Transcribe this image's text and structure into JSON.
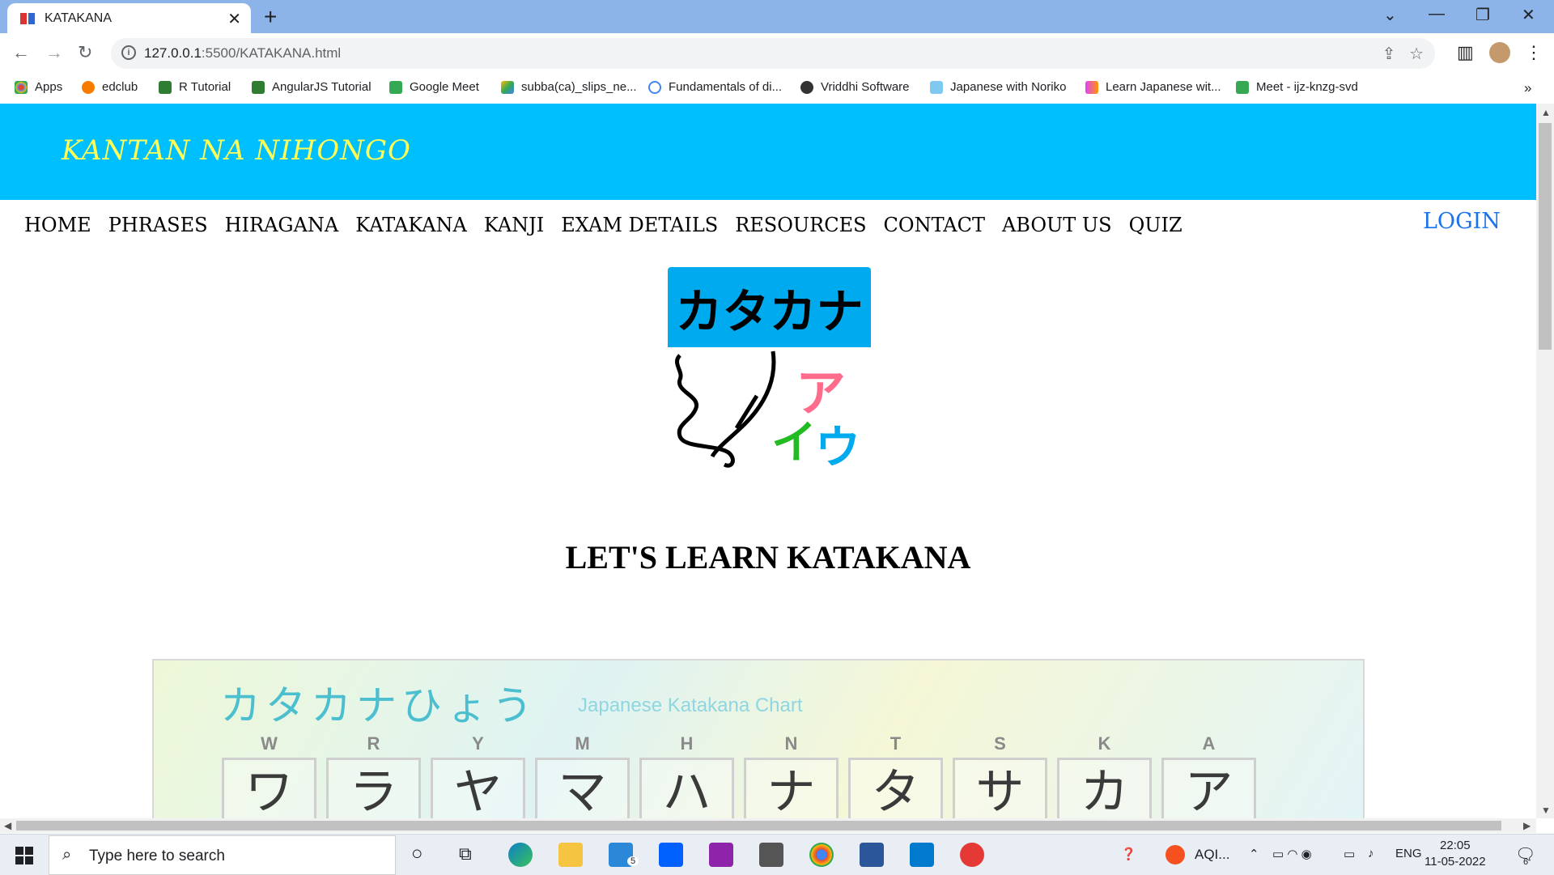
{
  "browser": {
    "tab_title": "KATAKANA",
    "url_host": "127.0.0.1",
    "url_rest": ":5500/KATAKANA.html",
    "bookmarks": [
      {
        "label": "Apps",
        "color": "#ea4335"
      },
      {
        "label": "edclub",
        "color": "#f57c00"
      },
      {
        "label": "R Tutorial",
        "color": "#2e7d32"
      },
      {
        "label": "AngularJS Tutorial",
        "color": "#2e7d32"
      },
      {
        "label": "Google Meet",
        "color": "#34a853"
      },
      {
        "label": "subba(ca)_slips_ne...",
        "color": "#fbbc04"
      },
      {
        "label": "Fundamentals of di...",
        "color": "#4285f4"
      },
      {
        "label": "Vriddhi Software",
        "color": "#333333"
      },
      {
        "label": "Japanese with Noriko",
        "color": "#7fc8f0"
      },
      {
        "label": "Learn Japanese wit...",
        "color": "#e040fb"
      },
      {
        "label": "Meet - ijz-knzg-svd",
        "color": "#34a853"
      }
    ]
  },
  "site": {
    "brand": "KANTAN NA NIHONGO",
    "nav": [
      "HOME",
      "PHRASES",
      "HIRAGANA",
      "KATAKANA",
      "KANJI",
      "EXAM DETAILS",
      "RESOURCES",
      "CONTACT",
      "ABOUT US",
      "QUIZ"
    ],
    "login": "LOGIN",
    "logo_text": "カタカナ",
    "logo_kana": [
      "ア",
      "イ",
      "ウ"
    ],
    "heading": "LET'S LEARN KATAKANA",
    "chart": {
      "title": "カタカナひょう",
      "subtitle": "Japanese Katakana Chart",
      "columns": [
        {
          "letter": "W",
          "kana": "ワ"
        },
        {
          "letter": "R",
          "kana": "ラ"
        },
        {
          "letter": "Y",
          "kana": "ヤ"
        },
        {
          "letter": "M",
          "kana": "マ"
        },
        {
          "letter": "H",
          "kana": "ハ"
        },
        {
          "letter": "N",
          "kana": "ナ"
        },
        {
          "letter": "T",
          "kana": "タ"
        },
        {
          "letter": "S",
          "kana": "サ"
        },
        {
          "letter": "K",
          "kana": "カ"
        },
        {
          "letter": "A",
          "kana": "ア"
        }
      ]
    }
  },
  "taskbar": {
    "search_placeholder": "Type here to search",
    "weather": "AQI...",
    "lang": "ENG",
    "time": "22:05",
    "date": "11-05-2022",
    "mail_badge": "5",
    "notif_badge": "6"
  }
}
